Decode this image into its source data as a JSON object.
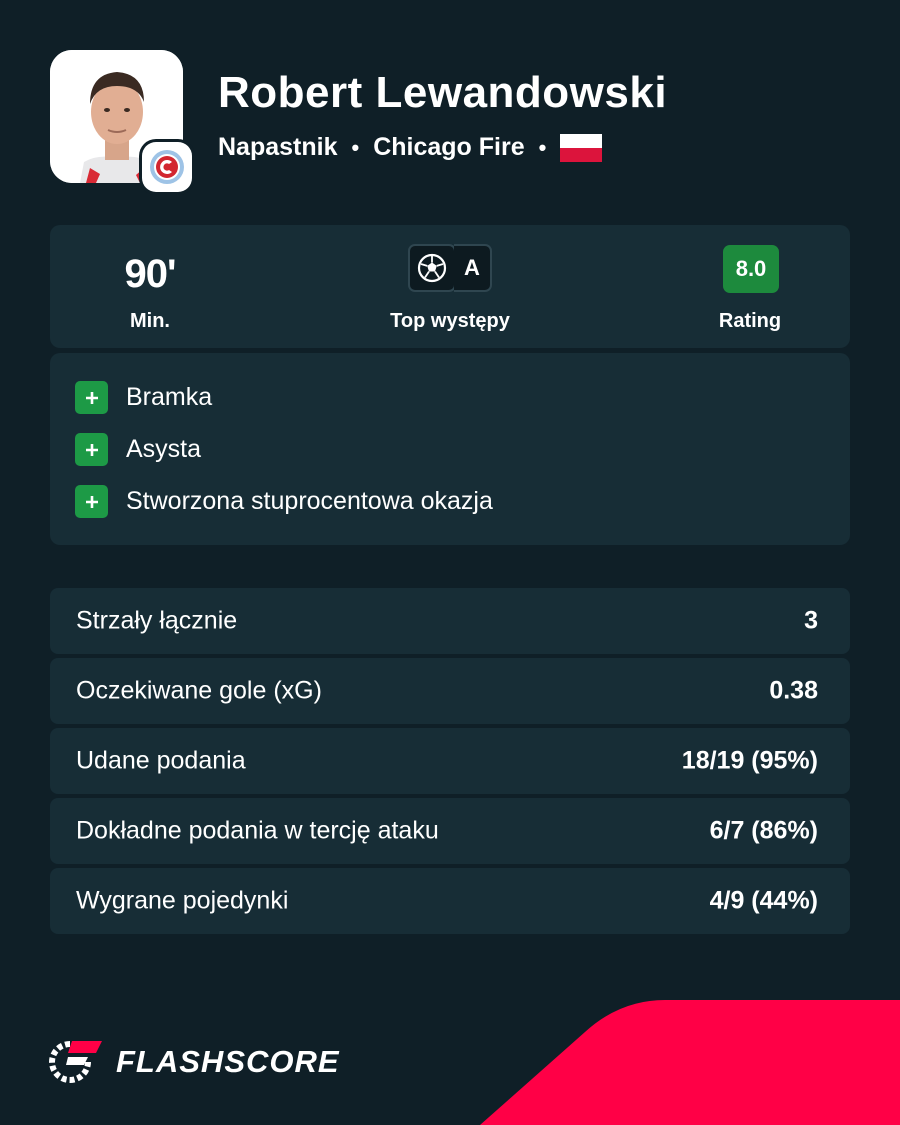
{
  "player": {
    "name": "Robert Lewandowski",
    "position": "Napastnik",
    "club": "Chicago Fire",
    "separator": "•",
    "nationality_flag": "poland-flag"
  },
  "summary": {
    "minutes": "90'",
    "minutes_label": "Min.",
    "top_performance_label": "Top występy",
    "top_badge_letter": "A",
    "rating": "8.0",
    "rating_label": "Rating",
    "rating_color": "#1d8a3d"
  },
  "events": [
    {
      "label": "Bramka"
    },
    {
      "label": "Asysta"
    },
    {
      "label": "Stworzona stuprocentowa okazja"
    }
  ],
  "stats": [
    {
      "label": "Strzały łącznie",
      "value": "3"
    },
    {
      "label": "Oczekiwane gole (xG)",
      "value": "0.38"
    },
    {
      "label": "Udane podania",
      "value": "18/19 (95%)"
    },
    {
      "label": "Dokładne podania w tercję ataku",
      "value": "6/7 (86%)"
    },
    {
      "label": "Wygrane pojedynki",
      "value": "4/9 (44%)"
    }
  ],
  "brand": {
    "name": "FLASHSCORE",
    "accent": "#ff0046",
    "background": "#0f1f27",
    "card": "#172d36"
  }
}
